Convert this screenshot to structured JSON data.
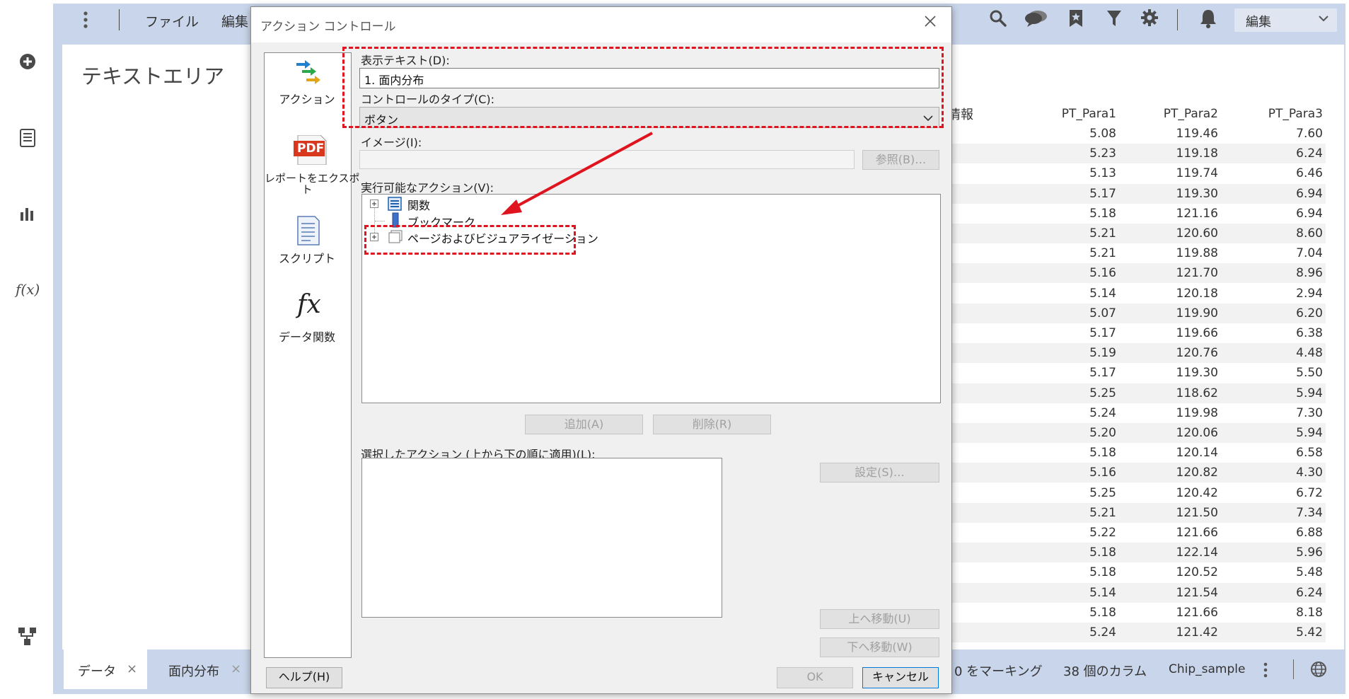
{
  "app": {
    "menu": {
      "file": "ファイル",
      "edit": "編集"
    },
    "edit_mode": "編集",
    "page_title": "テキストエリア",
    "sidebar_icons": [
      "add-icon",
      "data-panel-icon",
      "visualization-icon",
      "function-icon",
      "flow-icon"
    ]
  },
  "table": {
    "partial_header": "情報",
    "columns": [
      "PT_Para1",
      "PT_Para2",
      "PT_Para3"
    ],
    "rows": [
      [
        "5.08",
        "119.46",
        "7.60"
      ],
      [
        "5.23",
        "119.18",
        "6.24"
      ],
      [
        "5.13",
        "119.74",
        "6.46"
      ],
      [
        "5.17",
        "119.30",
        "6.94"
      ],
      [
        "5.18",
        "121.16",
        "6.94"
      ],
      [
        "5.21",
        "120.60",
        "8.60"
      ],
      [
        "5.21",
        "119.88",
        "7.04"
      ],
      [
        "5.16",
        "121.70",
        "8.96"
      ],
      [
        "5.14",
        "120.18",
        "2.94"
      ],
      [
        "5.07",
        "119.90",
        "6.20"
      ],
      [
        "5.17",
        "119.66",
        "6.38"
      ],
      [
        "5.19",
        "120.76",
        "4.48"
      ],
      [
        "5.17",
        "119.30",
        "5.50"
      ],
      [
        "5.25",
        "118.62",
        "5.94"
      ],
      [
        "5.24",
        "119.98",
        "7.30"
      ],
      [
        "5.20",
        "120.06",
        "5.94"
      ],
      [
        "5.18",
        "120.14",
        "6.58"
      ],
      [
        "5.16",
        "120.82",
        "4.30"
      ],
      [
        "5.25",
        "120.42",
        "6.72"
      ],
      [
        "5.21",
        "121.50",
        "7.34"
      ],
      [
        "5.22",
        "121.66",
        "6.88"
      ],
      [
        "5.18",
        "122.14",
        "5.96"
      ],
      [
        "5.18",
        "120.52",
        "5.48"
      ],
      [
        "5.14",
        "121.54",
        "6.24"
      ],
      [
        "5.18",
        "121.66",
        "8.18"
      ],
      [
        "5.24",
        "121.42",
        "5.42"
      ]
    ]
  },
  "statusbar": {
    "tabs": [
      {
        "label": "データ",
        "close": "×"
      },
      {
        "label": "面内分布",
        "close": "×"
      }
    ],
    "marking": "0 をマーキング",
    "columns_count": "38 個のカラム",
    "dataset": "Chip_sample"
  },
  "dialog": {
    "title": "アクション コントロール",
    "categories": [
      {
        "label": "アクション",
        "icon": "action-arrows-icon"
      },
      {
        "label": "レポートをエクスポート",
        "label_line1": "レポートをエクスポ",
        "label_line2": "ト",
        "icon": "pdf-icon"
      },
      {
        "label": "スクリプト",
        "icon": "script-icon"
      },
      {
        "label": "データ関数",
        "icon": "fx-icon"
      }
    ],
    "pdf_badge": "PDF",
    "fx_glyph": "fx",
    "display_text_label": "表示テキスト(D):",
    "display_text_value": "1. 面内分布",
    "control_type_label": "コントロールのタイプ(C):",
    "control_type_value": "ボタン",
    "image_label": "イメージ(I):",
    "browse_button": "参照(B)…",
    "available_actions_label": "実行可能なアクション(V):",
    "tree": [
      {
        "label": "関数",
        "expander": "+"
      },
      {
        "label": "ブックマーク",
        "expander": ""
      },
      {
        "label": "ページおよびビジュアライゼーション",
        "expander": "+"
      }
    ],
    "add_button": "追加(A)",
    "delete_button": "削除(R)",
    "selected_actions_label": "選択したアクション (上から下の順に適用)(L):",
    "settings_button": "設定(S)…",
    "move_up_button": "上へ移動(U)",
    "move_down_button": "下へ移動(W)",
    "help_button": "ヘルプ(H)",
    "ok_button": "OK",
    "cancel_button": "キャンセル"
  },
  "annotation_color": "#e0141e"
}
